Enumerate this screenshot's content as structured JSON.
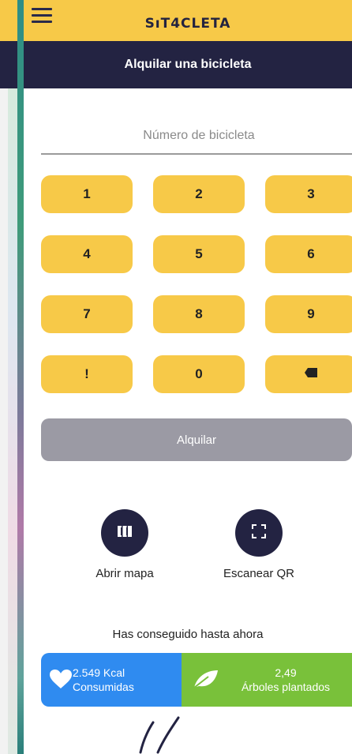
{
  "app": {
    "logo_text": "SıT4CLETA",
    "title": "Alquilar una bicicleta"
  },
  "bike_input": {
    "placeholder": "Número de bicicleta",
    "value": ""
  },
  "keypad": {
    "keys": [
      "1",
      "2",
      "3",
      "4",
      "5",
      "6",
      "7",
      "8",
      "9",
      "!",
      "0",
      "⌫"
    ]
  },
  "rent_button": {
    "label": "Alquilar"
  },
  "actions": {
    "map_label": "Abrir mapa",
    "scan_label": "Escanear QR"
  },
  "achievements": {
    "title": "Has conseguido hasta ahora",
    "kcal_value": "2.549 Kcal",
    "kcal_label": "Consumidas",
    "trees_value": "2,49",
    "trees_label": "Árboles plantados"
  },
  "colors": {
    "accent_yellow": "#f7c948",
    "navy": "#232342",
    "disabled_gray": "#9b9aa4",
    "kcal_blue": "#2f8bf0",
    "trees_green": "#79c13a"
  },
  "icons": {
    "menu": "hamburger-icon",
    "map": "map-icon",
    "scan": "qr-scan-icon",
    "heart": "heart-icon",
    "leaf": "leaf-icon",
    "backspace": "backspace-icon"
  }
}
